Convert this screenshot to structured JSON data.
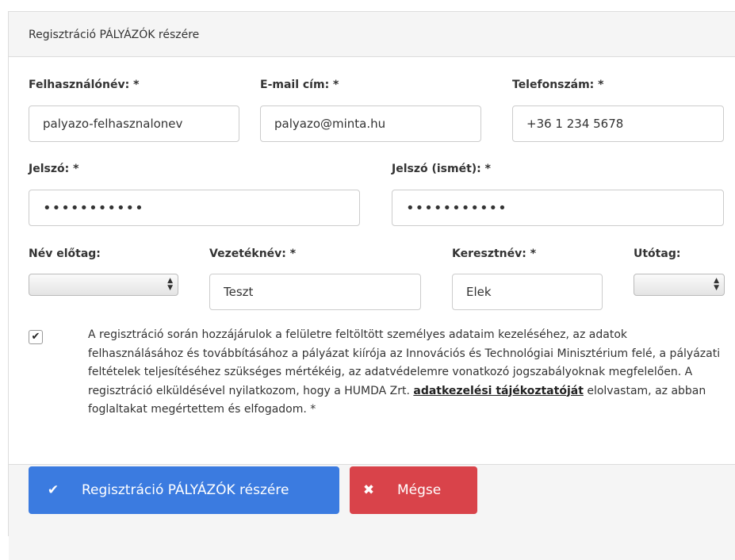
{
  "panel": {
    "title": "Regisztráció PÁLYÁZÓK részére"
  },
  "form": {
    "username": {
      "label": "Felhasználónév: *",
      "value": "palyazo-felhasznalonev"
    },
    "email": {
      "label": "E-mail cím: *",
      "value": "palyazo@minta.hu"
    },
    "phone": {
      "label": "Telefonszám: *",
      "value": "+36 1 234 5678"
    },
    "password": {
      "label": "Jelszó: *",
      "value": "•••••••••••"
    },
    "password_again": {
      "label": "Jelszó (ismét): *",
      "value": "•••••••••••"
    },
    "name_prefix": {
      "label": "Név előtag:",
      "value": ""
    },
    "last_name": {
      "label": "Vezetéknév: *",
      "value": "Teszt"
    },
    "first_name": {
      "label": "Keresztnév: *",
      "value": "Elek"
    },
    "name_suffix": {
      "label": "Utótag:",
      "value": ""
    }
  },
  "consent": {
    "checked": true,
    "text_before": "A regisztráció során hozzájárulok a felületre feltöltött személyes adataim kezeléséhez, az adatok felhasználásához és továbbításához a pályázat kiírója az Innovációs és Technológiai Minisztérium felé, a pályázati feltételek teljesítéséhez szükséges mértékéig, az adatvédelemre vonatkozó jogszabályoknak megfelelően. A regisztráció elküldésével nyilatkozom, hogy a HUMDA Zrt. ",
    "link_text": "adatkezelési tájékoztatóját",
    "text_after": " elolvastam, az abban foglaltakat megértettem és elfogadom.  *"
  },
  "buttons": {
    "submit": {
      "label": "Regisztráció PÁLYÁZÓK részére",
      "icon": "check-icon"
    },
    "cancel": {
      "label": "Mégse",
      "icon": "close-icon"
    }
  },
  "colors": {
    "primary": "#3b7be0",
    "danger": "#d9434a"
  }
}
